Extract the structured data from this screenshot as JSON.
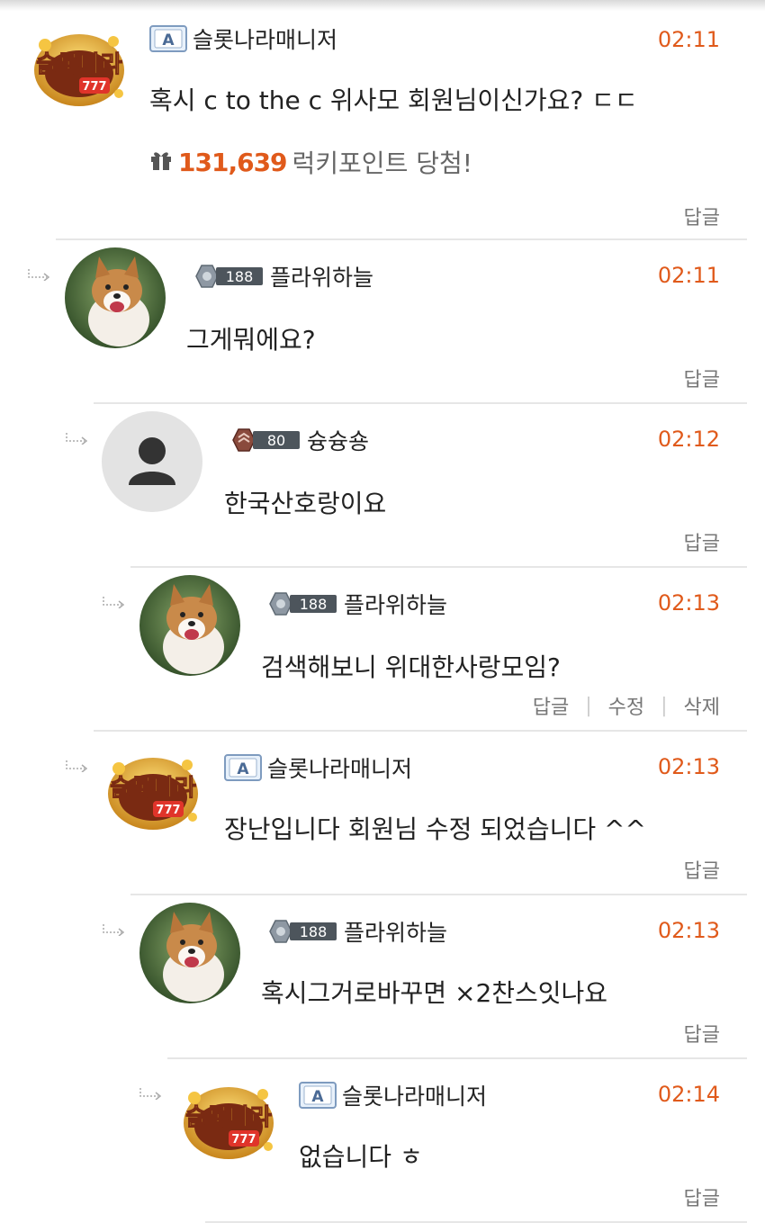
{
  "comments": [
    {
      "author": "슬롯나라매니저",
      "time": "02:11",
      "text": "혹시 c to the c 위사모 회원님이신가요? ㄷㄷ",
      "points": {
        "value": "131,639",
        "label": "럭키포인트 당첨!"
      },
      "actions": [
        "답글"
      ]
    },
    {
      "author": "플라위하늘",
      "level": "188",
      "time": "02:11",
      "text": "그게뭐에요?",
      "actions": [
        "답글"
      ]
    },
    {
      "author": "슝슝숑",
      "level": "80",
      "time": "02:12",
      "text": "한국산호랑이요",
      "actions": [
        "답글"
      ]
    },
    {
      "author": "플라위하늘",
      "level": "188",
      "time": "02:13",
      "text": "검색해보니 위대한사랑모임?",
      "actions": [
        "답글",
        "수정",
        "삭제"
      ]
    },
    {
      "author": "슬롯나라매니저",
      "time": "02:13",
      "text": "장난입니다 회원님 수정 되었습니다 ^^",
      "actions": [
        "답글"
      ]
    },
    {
      "author": "플라위하늘",
      "level": "188",
      "time": "02:13",
      "text": "혹시그거로바꾸면 ×2찬스잇나요",
      "actions": [
        "답글"
      ]
    },
    {
      "author": "슬롯나라매니저",
      "time": "02:14",
      "text": "없습니다 ㅎ",
      "actions": [
        "답글"
      ]
    }
  ],
  "icons": {
    "admin_badge": "admin-badge-icon",
    "level_badge": "level-badge-icon",
    "reply_arrow": "reply-arrow-icon",
    "gift": "gift-icon",
    "default_avatar": "person-icon"
  },
  "colors": {
    "accent": "#e05a1b",
    "text": "#222222",
    "muted": "#777777",
    "divider": "#e6e6e6"
  }
}
